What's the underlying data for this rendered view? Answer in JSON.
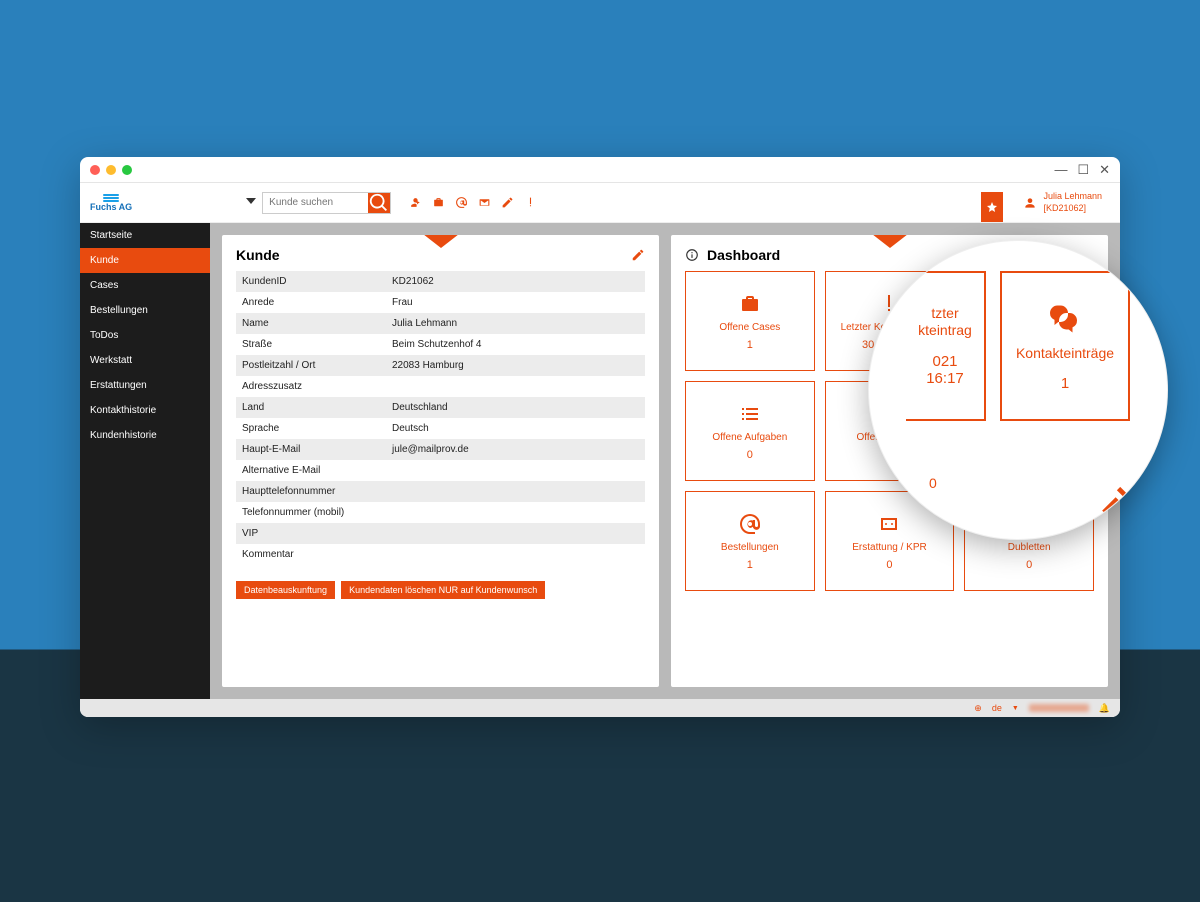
{
  "brand": "Fuchs AG",
  "search": {
    "placeholder": "Kunde suchen"
  },
  "user": {
    "name": "Julia Lehmann",
    "id": "[KD21062]"
  },
  "sidebar": [
    "Startseite",
    "Kunde",
    "Cases",
    "Bestellungen",
    "ToDos",
    "Werkstatt",
    "Erstattungen",
    "Kontakthistorie",
    "Kundenhistorie"
  ],
  "kunde": {
    "title": "Kunde",
    "rows": [
      {
        "k": "KundenID",
        "v": "KD21062"
      },
      {
        "k": "Anrede",
        "v": "Frau"
      },
      {
        "k": "Name",
        "v": "Julia Lehmann"
      },
      {
        "k": "Straße",
        "v": "Beim Schutzenhof 4"
      },
      {
        "k": "Postleitzahl / Ort",
        "v": "22083 Hamburg"
      },
      {
        "k": "Adresszusatz",
        "v": ""
      },
      {
        "k": "Land",
        "v": "Deutschland"
      },
      {
        "k": "Sprache",
        "v": "Deutsch"
      },
      {
        "k": "Haupt-E-Mail",
        "v": "jule@mailprov.de"
      },
      {
        "k": "Alternative E-Mail",
        "v": ""
      },
      {
        "k": "Haupttelefonnummer",
        "v": ""
      },
      {
        "k": "Telefonnummer (mobil)",
        "v": ""
      },
      {
        "k": "VIP",
        "v": ""
      },
      {
        "k": "Kommentar",
        "v": ""
      }
    ],
    "btn1": "Datenbeauskunftung",
    "btn2": "Kundendaten löschen NUR auf Kundenwunsch"
  },
  "dashboard": {
    "title": "Dashboard",
    "tiles": [
      {
        "label": "Offene Cases",
        "value": "1"
      },
      {
        "label": "Letzter Kontakteintrag",
        "value": "30.06.2021"
      },
      {
        "label": "",
        "value": ""
      },
      {
        "label": "Offene Aufgaben",
        "value": "0"
      },
      {
        "label": "Offene E-Mails",
        "value": "0"
      },
      {
        "label": "",
        "value": "0"
      },
      {
        "label": "Bestellungen",
        "value": "1"
      },
      {
        "label": "Erstattung / KPR",
        "value": "0"
      },
      {
        "label": "Dubletten",
        "value": "0"
      }
    ]
  },
  "zoom": {
    "left": {
      "label": "tzter\nkteintrag",
      "value": "021 16:17"
    },
    "right": {
      "label": "Kontakteinträge",
      "value": "1"
    },
    "zero": "0"
  },
  "footer": {
    "lang": "de"
  }
}
